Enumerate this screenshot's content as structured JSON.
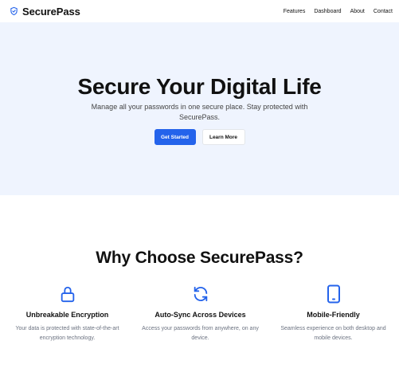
{
  "brand": {
    "name": "SecurePass",
    "icon": "shield-icon",
    "accent_color": "#2463eb"
  },
  "nav": {
    "links": [
      "Features",
      "Dashboard",
      "About",
      "Contact"
    ]
  },
  "hero": {
    "title": "Secure Your Digital Life",
    "subtitle": "Manage all your passwords in one secure place. Stay protected with SecurePass.",
    "primary_button": "Get Started",
    "secondary_button": "Learn More",
    "background_color": "#eff4fe"
  },
  "features": {
    "title": "Why Choose SecurePass?",
    "items": [
      {
        "icon": "lock-icon",
        "title": "Unbreakable Encryption",
        "description": "Your data is protected with state-of-the-art encryption technology."
      },
      {
        "icon": "sync-icon",
        "title": "Auto-Sync Across Devices",
        "description": "Access your passwords from anywhere, on any device."
      },
      {
        "icon": "mobile-icon",
        "title": "Mobile-Friendly",
        "description": "Seamless experience on both desktop and mobile devices."
      }
    ]
  }
}
